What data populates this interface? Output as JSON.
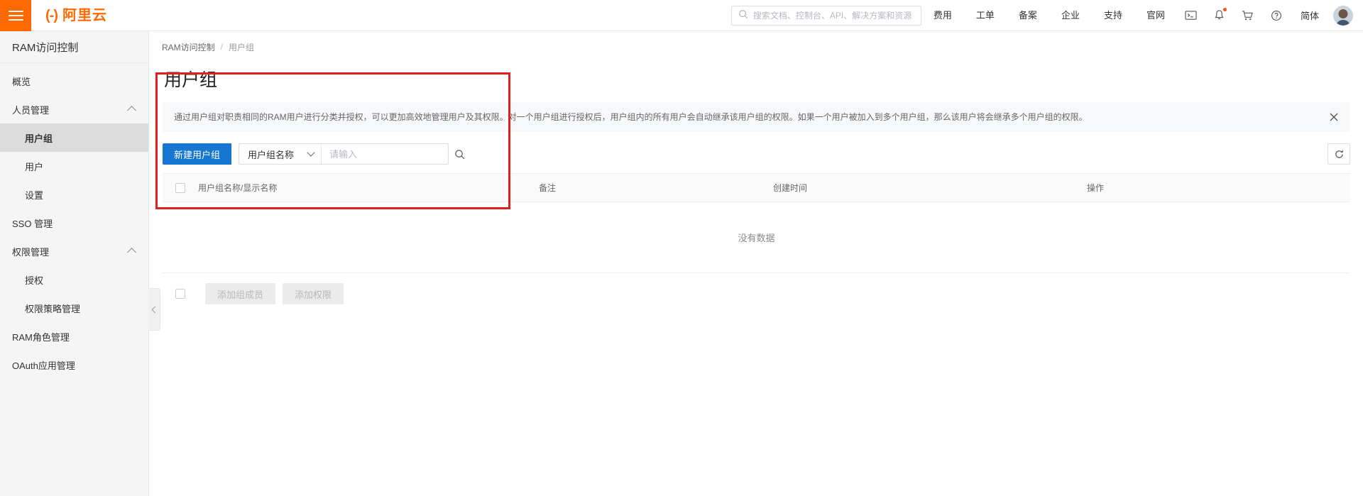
{
  "header": {
    "menu_icon": "hamburger-icon",
    "brand_mark": "(-)",
    "brand_text": "阿里云",
    "search": {
      "icon": "search-icon",
      "placeholder": "搜索文档、控制台、API、解决方案和资源",
      "value": ""
    },
    "nav": [
      {
        "label": "费用"
      },
      {
        "label": "工单"
      },
      {
        "label": "备案"
      },
      {
        "label": "企业"
      },
      {
        "label": "支持"
      },
      {
        "label": "官网"
      }
    ],
    "icons": [
      {
        "name": "terminal-icon"
      },
      {
        "name": "bell-icon",
        "badge": true
      },
      {
        "name": "cart-icon"
      },
      {
        "name": "help-icon"
      }
    ],
    "language": "简体",
    "avatar": "user-avatar"
  },
  "sidebar": {
    "title": "RAM访问控制",
    "items": [
      {
        "label": "概览",
        "level": 0,
        "active": false,
        "expandable": false
      },
      {
        "label": "人员管理",
        "level": 0,
        "active": false,
        "expandable": true,
        "expanded": true
      },
      {
        "label": "用户组",
        "level": 1,
        "active": true,
        "expandable": false
      },
      {
        "label": "用户",
        "level": 1,
        "active": false,
        "expandable": false
      },
      {
        "label": "设置",
        "level": 1,
        "active": false,
        "expandable": false
      },
      {
        "label": "SSO 管理",
        "level": 0,
        "active": false,
        "expandable": false
      },
      {
        "label": "权限管理",
        "level": 0,
        "active": false,
        "expandable": true,
        "expanded": true
      },
      {
        "label": "授权",
        "level": 1,
        "active": false,
        "expandable": false
      },
      {
        "label": "权限策略管理",
        "level": 1,
        "active": false,
        "expandable": false
      },
      {
        "label": "RAM角色管理",
        "level": 0,
        "active": false,
        "expandable": false
      },
      {
        "label": "OAuth应用管理",
        "level": 0,
        "active": false,
        "expandable": false
      }
    ],
    "collapse_icon": "chevron-left-icon"
  },
  "breadcrumb": {
    "root": "RAM访问控制",
    "separator": "/",
    "current": "用户组"
  },
  "page": {
    "title": "用户组",
    "banner": {
      "text": "通过用户组对职责相同的RAM用户进行分类并授权，可以更加高效地管理用户及其权限。对一个用户组进行授权后，用户组内的所有用户会自动继承该用户组的权限。如果一个用户被加入到多个用户组，那么该用户将会继承多个用户组的权限。",
      "close_icon": "close-icon"
    },
    "toolbar": {
      "create_label": "新建用户组",
      "filter_selected": "用户组名称",
      "filter_chevron": "chevron-down-icon",
      "search_placeholder": "请输入",
      "search_value": "",
      "search_icon": "search-icon",
      "refresh_icon": "refresh-icon"
    },
    "table": {
      "columns": [
        "用户组名称/显示名称",
        "备注",
        "创建时间",
        "操作"
      ],
      "rows": [],
      "empty_text": "没有数据"
    },
    "bottom_actions": [
      {
        "label": "添加组成员",
        "disabled": true
      },
      {
        "label": "添加权限",
        "disabled": true
      }
    ]
  },
  "annotation": {
    "color": "#e02020"
  }
}
